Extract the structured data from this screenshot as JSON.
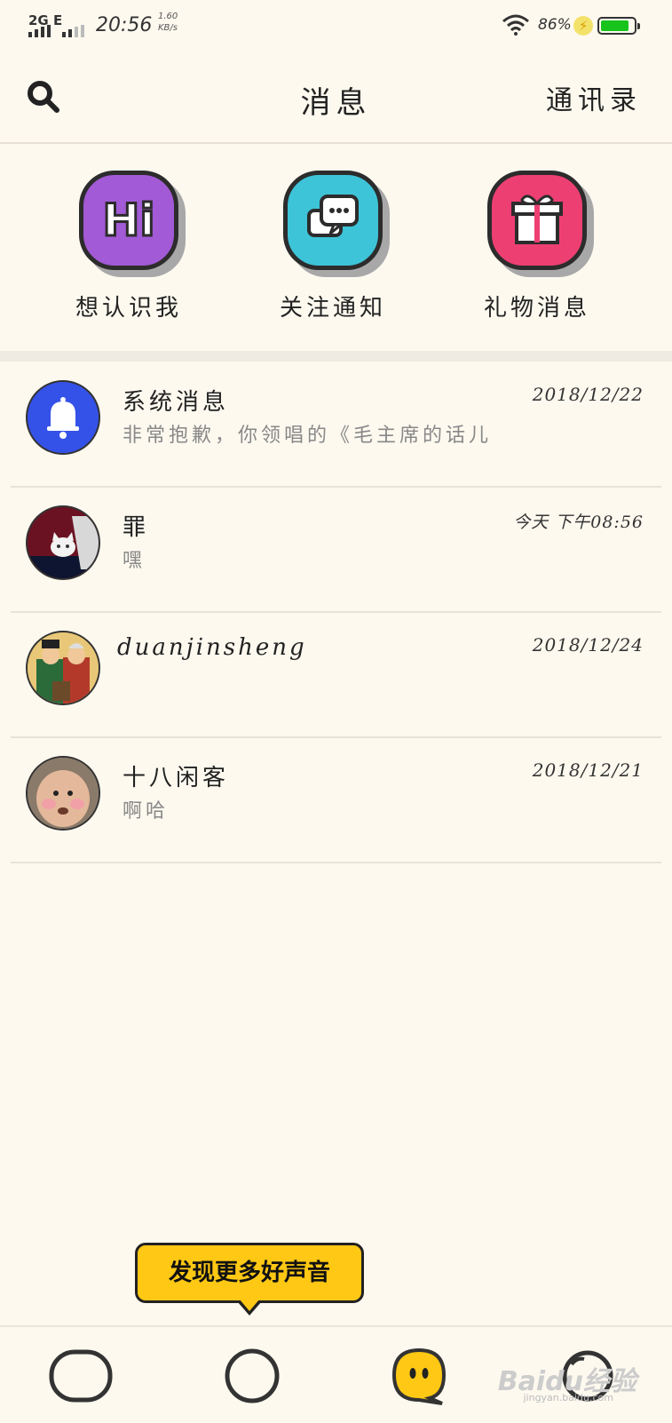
{
  "status_bar": {
    "network": "2G E",
    "time": "20:56",
    "speed_value": "1.60",
    "speed_unit": "KB/s",
    "battery_percent": "86%",
    "battery_level": 0.86,
    "battery_color": "#18c41c"
  },
  "header": {
    "title": "消息",
    "contacts_label": "通讯录"
  },
  "quick_actions": [
    {
      "label": "想认识我",
      "icon": "hi-icon",
      "color": "#a35ad6"
    },
    {
      "label": "关注通知",
      "icon": "chat-bubbles-icon",
      "color": "#3ec4d8"
    },
    {
      "label": "礼物消息",
      "icon": "gift-icon",
      "color": "#ee3f73"
    }
  ],
  "messages": [
    {
      "name": "系统消息",
      "date": "2018/12/22",
      "preview": "非常抱歉，你领唱的《毛主席的话儿",
      "avatar": "bell-icon"
    },
    {
      "name": "罪",
      "date": "今天  下午08:56",
      "preview": "嘿",
      "avatar": "kitten-photo"
    },
    {
      "name": "duanjinsheng",
      "date": "2018/12/24",
      "preview": "",
      "avatar": "painting-photo"
    },
    {
      "name": "十八闲客",
      "date": "2018/12/21",
      "preview": "啊哈",
      "avatar": "face-photo"
    }
  ],
  "tooltip": {
    "text": "发现更多好声音"
  },
  "bottom_nav": [
    {
      "icon": "home-tab-icon"
    },
    {
      "icon": "discover-tab-icon"
    },
    {
      "icon": "messages-tab-icon"
    },
    {
      "icon": "profile-tab-icon"
    }
  ],
  "watermark": {
    "brand": "Baidu经验",
    "url": "jingyan.baidu.com"
  },
  "accent_color": "#ffc814"
}
